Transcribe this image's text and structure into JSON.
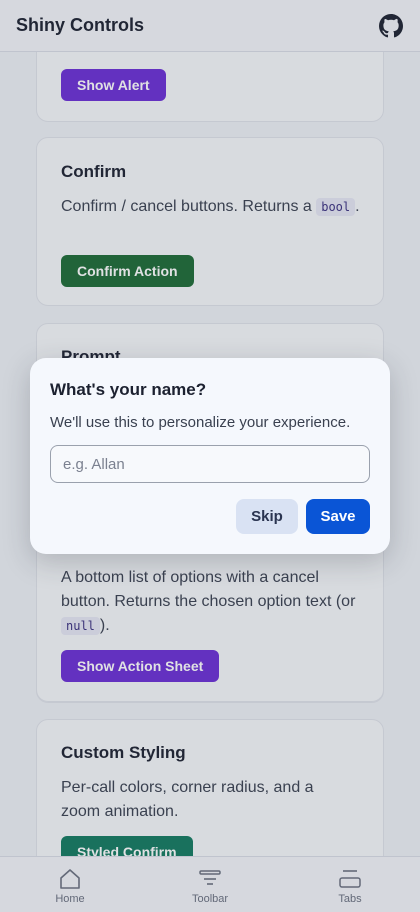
{
  "header": {
    "title": "Shiny Controls",
    "github_icon": "github-icon"
  },
  "cards": {
    "alert": {
      "button": "Show Alert"
    },
    "confirm": {
      "title": "Confirm",
      "desc_before": "Confirm / cancel buttons. Returns a",
      "code": "bool",
      "desc_after": ".",
      "button": "Confirm Action"
    },
    "prompt": {
      "title": "Prompt"
    },
    "action_sheet": {
      "desc_before": "A bottom list of options with a cancel button. Returns the chosen option text (or",
      "code": "null",
      "desc_after": ").",
      "button": "Show Action Sheet"
    },
    "custom": {
      "title": "Custom Styling",
      "desc": "Per-call colors, corner radius, and a zoom animation.",
      "button": "Styled Confirm"
    }
  },
  "tabs": [
    {
      "label": "Home",
      "icon": "home-icon"
    },
    {
      "label": "Toolbar",
      "icon": "toolbar-icon"
    },
    {
      "label": "Tabs",
      "icon": "tabs-icon"
    }
  ],
  "dialog": {
    "title": "What's your name?",
    "message": "We'll use this to personalize your experience.",
    "input_value": "",
    "input_placeholder": "e.g. Allan",
    "skip_label": "Skip",
    "save_label": "Save"
  },
  "colors": {
    "purple": "#6a2ed6",
    "dark_green": "#1c6b35",
    "teal": "#137a60",
    "save_blue": "#0a55d6",
    "skip_bg": "#d9e2f3"
  }
}
